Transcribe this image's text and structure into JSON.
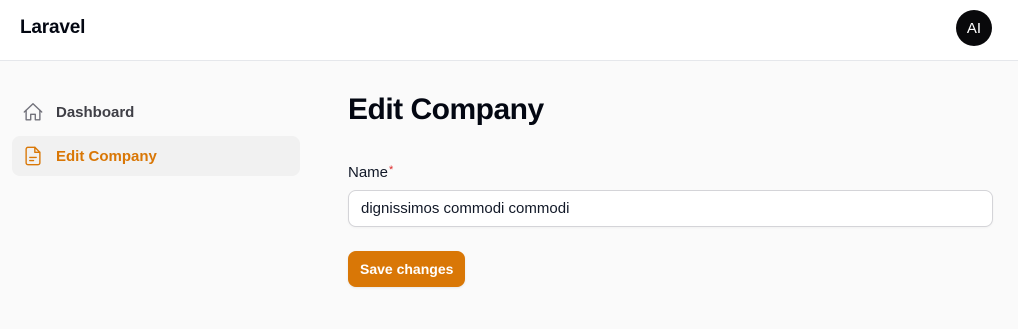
{
  "header": {
    "brand": "Laravel",
    "avatar_initials": "AI"
  },
  "sidebar": {
    "items": [
      {
        "label": "Dashboard",
        "icon": "home-icon",
        "active": false
      },
      {
        "label": "Edit Company",
        "icon": "document-icon",
        "active": true
      }
    ]
  },
  "main": {
    "title": "Edit Company",
    "form": {
      "name_label": "Name",
      "required_mark": "*",
      "name_value": "dignissimos commodi commodi",
      "save_label": "Save changes"
    }
  },
  "colors": {
    "accent": "#d97706",
    "required": "#dc2626",
    "background": "#fafafa",
    "avatar_bg": "#09090b"
  }
}
